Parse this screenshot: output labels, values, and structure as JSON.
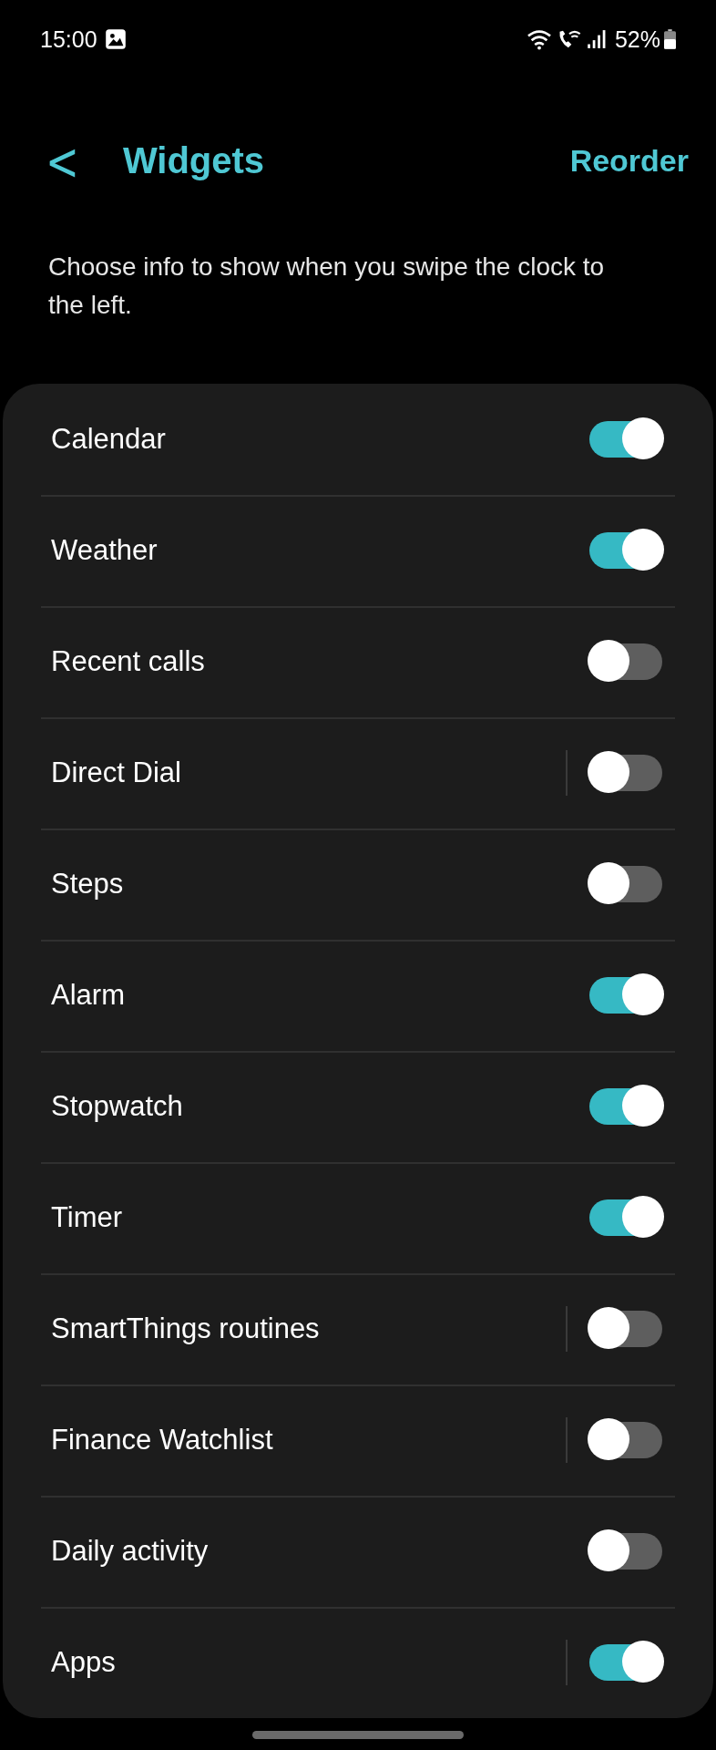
{
  "status_bar": {
    "time": "15:00",
    "battery": "52%"
  },
  "header": {
    "back": "<",
    "title": "Widgets",
    "action": "Reorder"
  },
  "description": "Choose info to show when you swipe the clock to the left.",
  "widgets": [
    {
      "label": "Calendar",
      "on": true,
      "separator": false
    },
    {
      "label": "Weather",
      "on": true,
      "separator": false
    },
    {
      "label": "Recent calls",
      "on": false,
      "separator": false
    },
    {
      "label": "Direct Dial",
      "on": false,
      "separator": true
    },
    {
      "label": "Steps",
      "on": false,
      "separator": false
    },
    {
      "label": "Alarm",
      "on": true,
      "separator": false
    },
    {
      "label": "Stopwatch",
      "on": true,
      "separator": false
    },
    {
      "label": "Timer",
      "on": true,
      "separator": false
    },
    {
      "label": "SmartThings routines",
      "on": false,
      "separator": true
    },
    {
      "label": "Finance Watchlist",
      "on": false,
      "separator": true
    },
    {
      "label": "Daily activity",
      "on": false,
      "separator": false
    },
    {
      "label": "Apps",
      "on": true,
      "separator": true
    }
  ]
}
